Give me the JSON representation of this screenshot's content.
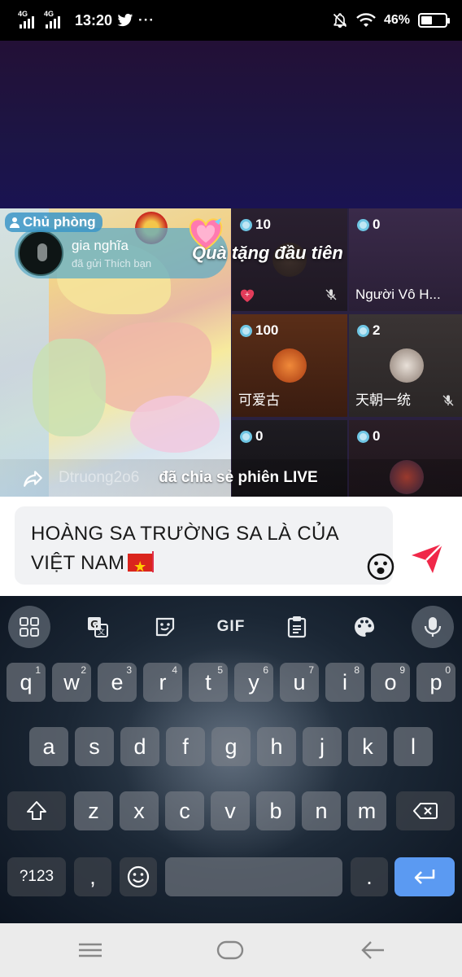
{
  "status_bar": {
    "network_1": "4G",
    "network_2": "4G",
    "time": "13:20",
    "notif_icons": [
      "twitter-icon",
      "more-dots-icon"
    ],
    "battery": "46%",
    "battery_level": 0.46
  },
  "live": {
    "host_label": "Chủ phòng",
    "host_name": "gia nghĩa",
    "host_subtitle": "đã gửi Thích bạn",
    "gift_banner": "Quà tặng đầu tiên",
    "share_user": "Dtruong2o6",
    "share_text": "đã chia sẻ phiên LIVE",
    "seats": [
      {
        "coins": "10",
        "name": "",
        "muted": true,
        "gift_heart": true
      },
      {
        "coins": "0",
        "name": "Người  Vô  H...",
        "muted": false
      },
      {
        "coins": "100",
        "name": "可爱古",
        "muted": false
      },
      {
        "coins": "2",
        "name": "天朝一统",
        "muted": true
      },
      {
        "coins": "0",
        "name": "",
        "muted": false
      },
      {
        "coins": "0",
        "name": "",
        "muted": false
      }
    ]
  },
  "input": {
    "text": "HOÀNG SA TRƯỜNG SA LÀ CỦA VIỆT NAM"
  },
  "keyboard": {
    "toolbar": [
      "apps-grid-icon",
      "translate-icon",
      "sticker-icon",
      "GIF",
      "clipboard-icon",
      "palette-icon",
      "mic-icon"
    ],
    "row1": [
      "q",
      "w",
      "e",
      "r",
      "t",
      "y",
      "u",
      "i",
      "o",
      "p"
    ],
    "row1_hints": [
      "1",
      "2",
      "3",
      "4",
      "5",
      "6",
      "7",
      "8",
      "9",
      "0"
    ],
    "row2": [
      "a",
      "s",
      "d",
      "f",
      "g",
      "h",
      "j",
      "k",
      "l"
    ],
    "row3": [
      "z",
      "x",
      "c",
      "v",
      "b",
      "n",
      "m"
    ],
    "sym_label": "?123",
    "comma": ",",
    "period": "."
  },
  "nav": [
    "recents-icon",
    "home-icon",
    "back-icon"
  ]
}
